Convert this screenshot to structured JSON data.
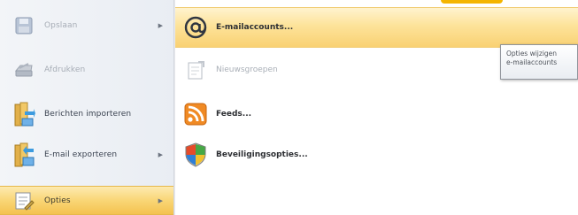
{
  "menu": {
    "left_items": [
      {
        "label": "Opslaan",
        "icon": "save-icon",
        "disabled": true,
        "has_submenu": true,
        "selected": false
      },
      {
        "label": "Afdrukken",
        "icon": "printer-icon",
        "disabled": true,
        "has_submenu": false,
        "selected": false
      },
      {
        "label": "Berichten importeren",
        "icon": "import-messages-icon",
        "disabled": false,
        "has_submenu": false,
        "selected": false
      },
      {
        "label": "E-mail exporteren",
        "icon": "export-email-icon",
        "disabled": false,
        "has_submenu": true,
        "selected": false
      },
      {
        "label": "Opties",
        "icon": "options-icon",
        "disabled": false,
        "has_submenu": true,
        "selected": true
      }
    ],
    "right_items": [
      {
        "label": "E-mailaccounts...",
        "icon": "at-sign-icon",
        "disabled": false,
        "highlighted": true
      },
      {
        "label": "Nieuwsgroepen",
        "icon": "newsgroups-icon",
        "disabled": true,
        "highlighted": false
      },
      {
        "label": "Feeds...",
        "icon": "rss-feed-icon",
        "disabled": false,
        "highlighted": false
      },
      {
        "label": "Beveiligingsopties...",
        "icon": "security-shield-icon",
        "disabled": false,
        "highlighted": false
      }
    ]
  },
  "tooltip": {
    "line1": "Opties wijzigen",
    "line2": "e-mailaccounts"
  },
  "colors": {
    "selection_gold": "#f9d676",
    "highlight_light": "#fde39a"
  }
}
